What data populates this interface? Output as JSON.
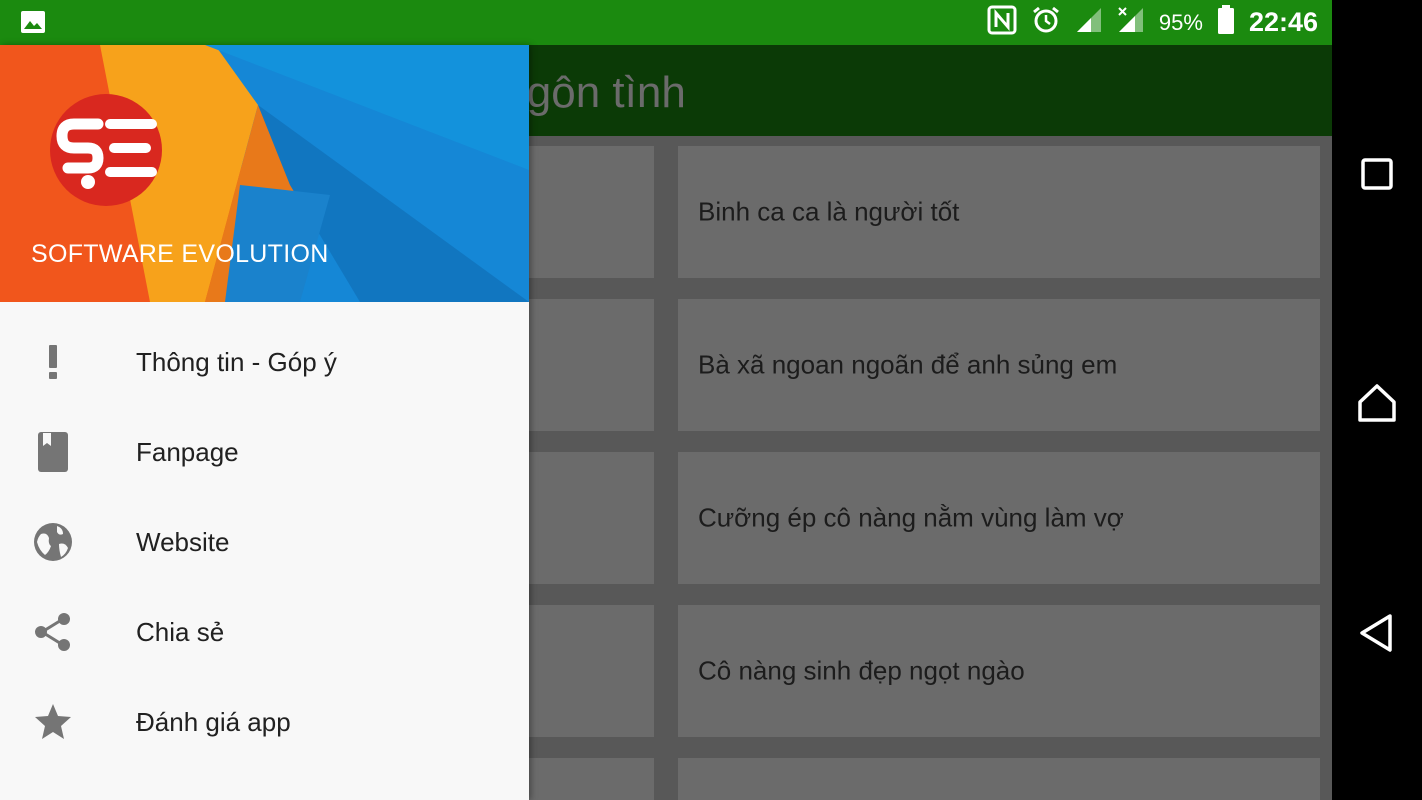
{
  "status_bar": {
    "battery_percent": "95%",
    "time": "22:46",
    "icons": [
      "image-icon",
      "nfc-icon",
      "alarm-icon",
      "signal-icon",
      "signal-no-data-icon",
      "battery-icon"
    ]
  },
  "app_bar": {
    "title": "ruyện ngôn tình"
  },
  "stories": {
    "rows": [
      {
        "title": "Binh ca ca là người tốt"
      },
      {
        "title": "Bà xã ngoan ngoãn để anh sủng em"
      },
      {
        "title": "Cưỡng ép cô nàng nằm vùng làm vợ"
      },
      {
        "title": "Cô nàng sinh đẹp ngọt ngào"
      },
      {
        "title": ""
      }
    ]
  },
  "drawer": {
    "brand": "SOFTWARE EVOLUTION",
    "logo_text": "SE",
    "items": [
      {
        "label": "Thông tin - Góp ý",
        "icon": "info-exclamation-icon"
      },
      {
        "label": "Fanpage",
        "icon": "book-icon"
      },
      {
        "label": "Website",
        "icon": "globe-icon"
      },
      {
        "label": "Chia sẻ",
        "icon": "share-icon"
      },
      {
        "label": "Đánh giá app",
        "icon": "star-icon"
      }
    ]
  },
  "navigation_bar": {
    "buttons": [
      "recents-button",
      "home-button",
      "back-button"
    ]
  },
  "colors": {
    "status_bar": "#1b8a0f",
    "app_bar_dimmed": "#0b3a06",
    "drawer_background": "#f8f8f8",
    "menu_icon": "#757575",
    "logo_red": "#d9281f"
  }
}
